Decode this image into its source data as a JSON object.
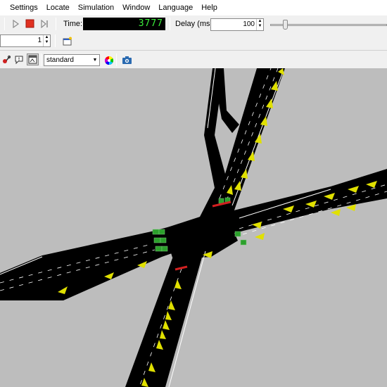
{
  "menu": {
    "items": [
      "Settings",
      "Locate",
      "Simulation",
      "Window",
      "Language",
      "Help"
    ]
  },
  "toolbar": {
    "time_label": "Time:",
    "time_value": "3777",
    "delay_label": "Delay (ms):",
    "delay_value": "100",
    "delay_fraction": 0.07,
    "step_value": "1",
    "scheme_value": "standard"
  },
  "colors": {
    "canvas_background": "#bdbdbd",
    "road": "#000000",
    "vehicle": "#e0e000",
    "detector": "#2ca02c",
    "signal_red": "#d22020",
    "time_digits": "#3cf03c"
  },
  "icons": {
    "play": "play-icon",
    "stop": "stop-icon",
    "step": "step-icon",
    "new_view": "new-view-icon",
    "locate": "locate-icon",
    "chat": "chat-icon",
    "viewport": "viewport-icon",
    "color_wheel": "color-wheel-icon",
    "screenshot": "screenshot-icon"
  }
}
